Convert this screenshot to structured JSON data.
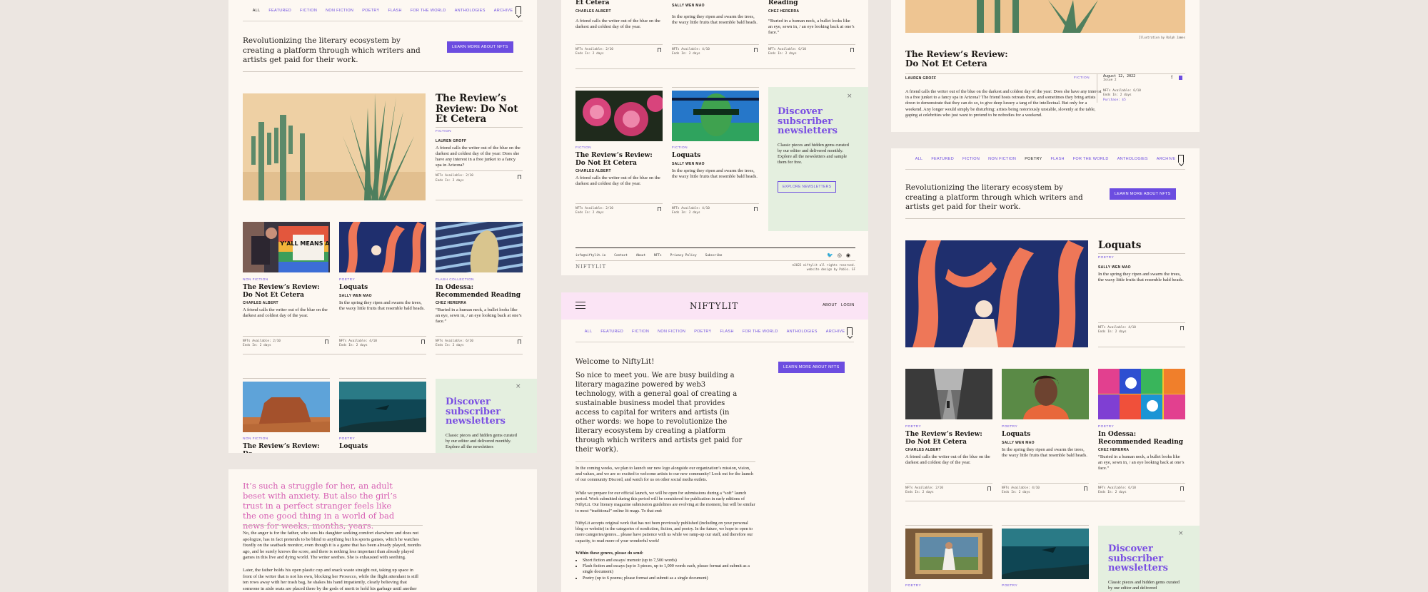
{
  "nav": [
    "ALL",
    "FEATURED",
    "FICTION",
    "NON FICTION",
    "POETRY",
    "FLASH",
    "FOR THE WORLD",
    "ANTHOLOGIES",
    "ARCHIVE"
  ],
  "intro_text": "Revolutionizing the literary ecosystem by creating a platform through which writers and artists get paid for their work.",
  "learn_more": "LEARN MORE ABOUT NFTS",
  "feature": {
    "title": "The Review’s Review: Do Not Et Cetera",
    "category": "FICTION",
    "author": "LAUREN GROFF",
    "excerpt": "A friend calls the writer out of the blue on the darkest and coldest day of the year: Does she have any interest in a free junket to a fancy spa in Arizona?",
    "meta1": "NFTs Available: 2/10",
    "meta2": "Ends In: 2 days"
  },
  "cards": [
    {
      "category": "NON FICTION",
      "title": "The Review’s Review: Do Not Et Cetera",
      "author": "CHARLES ALBERT",
      "excerpt": "A friend calls the writer out of the blue on the darkest and coldest day of the year.",
      "meta1": "NFTs Available: 2/10",
      "meta2": "Ends In: 2 days",
      "sign": "Y’ALL MEANS ALL"
    },
    {
      "category": "POETRY",
      "title": "Loquats",
      "author": "SALLY WEN MAO",
      "excerpt": "In the spring they ripen and swarm the trees, the waxy little fruits that resemble bald heads.",
      "meta1": "NFTs Available: 4/10",
      "meta2": "Ends In: 2 days"
    },
    {
      "category": "FLASH COLLECTION",
      "title": "In Odessa: Recommended Reading",
      "author": "CHEZ HERERRA",
      "excerpt": "“Buried in a human neck, a bullet looks like an eye, sewn in, / an eye looking back at one’s face.”",
      "meta1": "NFTs Available: 6/10",
      "meta2": "Ends In: 2 days"
    }
  ],
  "cards_row2": [
    {
      "category": "NON FICTION",
      "title": "The Review’s Review: Do"
    },
    {
      "category": "POETRY",
      "title": "Loquats"
    }
  ],
  "middle_top": {
    "titles": [
      "Et Cetera",
      "Reading"
    ],
    "authors": [
      "CHARLES ALBERT",
      "SALLY WEN MAO",
      "CHEZ HERERRA"
    ],
    "excerpts": [
      "A friend calls the writer out of the blue on the darkest and coldest day of the year.",
      "In the spring they ripen and swarm the trees, the waxy little fruits that resemble bald heads.",
      "“Buried in a human neck, a bullet looks like an eye, sewn in, / an eye looking back at one’s face.”"
    ],
    "metas": [
      [
        "NFTs Available: 2/10",
        "Ends In: 2 days"
      ],
      [
        "NFTs Available: 4/10",
        "Ends In: 2 days"
      ],
      [
        "NFTs Available: 6/10",
        "Ends In: 2 days"
      ]
    ]
  },
  "middle_cards": [
    {
      "category": "FICTION",
      "title": "The Review’s Review: Do Not Et Cetera",
      "author": "CHARLES ALBERT",
      "excerpt": "A friend calls the writer out of the blue on the darkest and coldest day of the year.",
      "meta1": "NFTs Available: 2/10",
      "meta2": "Ends In: 2 days"
    },
    {
      "category": "FICTION",
      "title": "Loquats",
      "author": "SALLY WEN MAO",
      "excerpt": "In the spring they ripen and swarm the trees, the waxy little fruits that resemble bald heads.",
      "meta1": "NFTs Available: 4/10",
      "meta2": "Ends In: 2 days"
    }
  ],
  "promo": {
    "heading": "Discover subscriber newsletters",
    "body": "Classic pieces and hidden gems curated by our editor and delivered monthly.  Explore all the newsletters and sample them for free.",
    "body_short": "Classic pieces and hidden gems curated by our editor and delivered monthly.  Explore all the newsletters",
    "body_short2": "Classic pieces and hidden gems curated by our editor and delivered",
    "button": "EXPLORE NEWSLETTERS"
  },
  "footer": {
    "email": "info@niftylit.io",
    "links": [
      "Contact",
      "About",
      "NFTs",
      "Privacy Policy",
      "Subscribe"
    ],
    "logo": "NIFTYLIT",
    "copyright": "©2022 niftylit all rights reserved.",
    "credit": "website design by Pablo. SF"
  },
  "welcome_page": {
    "logo": "NIFTYLIT",
    "about": "ABOUT",
    "login": "LOGIN",
    "heading": "Welcome to NiftyLit!",
    "lede": "So nice to meet you. We are busy building a literary magazine powered by web3 technology, with a general goal of creating a sustainable business model that provides access to capital for writers and artists (in other words: we hope to revolutionize the literary ecosystem by creating a platform through which writers and artists get paid for their work).",
    "p1": "In the coming weeks, we plan to launch our new logo alongside our organization’s mission, vision, and values, and we are so excited to welcome artists to our new community! Look out for the launch of our community Discord, and watch for us on other social media outlets.",
    "p2": "While we prepare for our official launch, we will be open for submissions during a “soft” launch period. Work submitted during this period will be considered for publication in early editions of NiftyLit. Our literary magazine submission guidelines are evolving at the moment, but will be similar to most “traditional” online lit mags. To that end:",
    "p3": "NiftyLit accepts original work that has not been previously published (including on your personal blog or website) in the categories of nonfiction, fiction, and poetry. In the future, we hope to open to more categories/genres... please have patience with us while we ramp-up our staff, and therefore our capacity, to read more of your wonderful work!",
    "list_heading": "Within these genres, please do send:",
    "list": [
      "Short fiction and essays/ memoir (up to 7,500 words)",
      "Flash fiction and essays (up to 3 pieces, up to 1,000 words each, please format and submit as a single document)",
      "Poetry (up to 6 poems; please format and submit as a single document)"
    ]
  },
  "story_page": {
    "pull_quote": "It’s such a struggle for her, an adult beset with anxiety. But also the girl’s trust in a perfect stranger feels like the one good thing in a world of bad news for weeks, months, years.",
    "p1": "No, the anger is for the father, who sees his daughter seeking comfort elsewhere and does not apologize, has in fact pretends to be blind to anything but his sports games, which he watches fixedly on the seatback monitor, even though it is a game that has been already played, months ago, and he surely knows the score, and there is nothing less important than already played games in this live and dying world. The writer seethes. She is exhausted with seething.",
    "p2": "Later, the father holds his open plastic cup and snack waste straight out, taking up space in front of the writer that is not his own, blocking her Prosecco, while the flight attendant is still ten rows away with her trash bag, he shakes his hand impatiently, clearly believing that someone in aisle seats are placed there by the gods of merit to hold his garbage until another woman comes"
  },
  "detail_page": {
    "credit": "Illustration by Ralph James",
    "title": "The Review’s Review: Do Not Et Cetera",
    "author": "LAUREN GROFF",
    "category": "FICTION",
    "body": "A friend calls the writer out of the blue on the darkest and coldest day of the year: Does she have any interest in a free junket to a fancy spa in Arizona? The friend hosts retreats there, and sometimes they bring artists down to demonstrate that they can do so, to give deep luxury a tang of the intellectual. But only for a weekend. Any longer would simply be disturbing: artists being notoriously unstable, slovenly at the table, gaping at celebrities who just want to pretend to be nobodies for a weekend.",
    "date": "August 12, 2022",
    "issue": "Issue 2",
    "meta1": "NFTs Available: 6/10",
    "meta2": "Ends In: 2 days",
    "purchase": "Purchase: $5"
  },
  "right_page": {
    "active_nav": "POETRY",
    "feature": {
      "title": "Loquats",
      "category": "POETRY",
      "author": "SALLY WEN MAO",
      "excerpt": "In the spring they ripen and swarm the trees, the waxy little fruits that resemble bald heads.",
      "meta1": "NFTs Available: 4/10",
      "meta2": "Ends In: 2 days"
    },
    "cards": [
      {
        "category": "POETRY",
        "title": "The Review’s Review: Do Not Et Cetera",
        "author": "CHARLES ALBERT",
        "excerpt": "A friend calls the writer out of the blue on the darkest and coldest day of the year.",
        "meta1": "NFTs Available: 2/10",
        "meta2": "Ends In: 2 days"
      },
      {
        "category": "POETRY",
        "title": "Loquats",
        "author": "SALLY WEN MAO",
        "excerpt": "In the spring they ripen and swarm the trees, the waxy little fruits that resemble bald heads.",
        "meta1": "NFTs Available: 4/10",
        "meta2": "Ends In: 2 days"
      },
      {
        "category": "POETRY",
        "title": "In Odessa: Recommended Reading",
        "author": "CHEZ HERERRA",
        "excerpt": "“Buried in a human neck, a bullet looks like an eye, sewn in, / an eye looking back at one’s face.”",
        "meta1": "NFTs Available: 6/10",
        "meta2": "Ends In: 2 days"
      }
    ],
    "row2": [
      "POETRY",
      "POETRY"
    ]
  },
  "colors": {
    "accent": "#6c4de0",
    "paper": "#fdf8f2",
    "promo": "#e4efdf",
    "pink_header": "#fbe4f5",
    "pink_text": "#d65fb3"
  }
}
